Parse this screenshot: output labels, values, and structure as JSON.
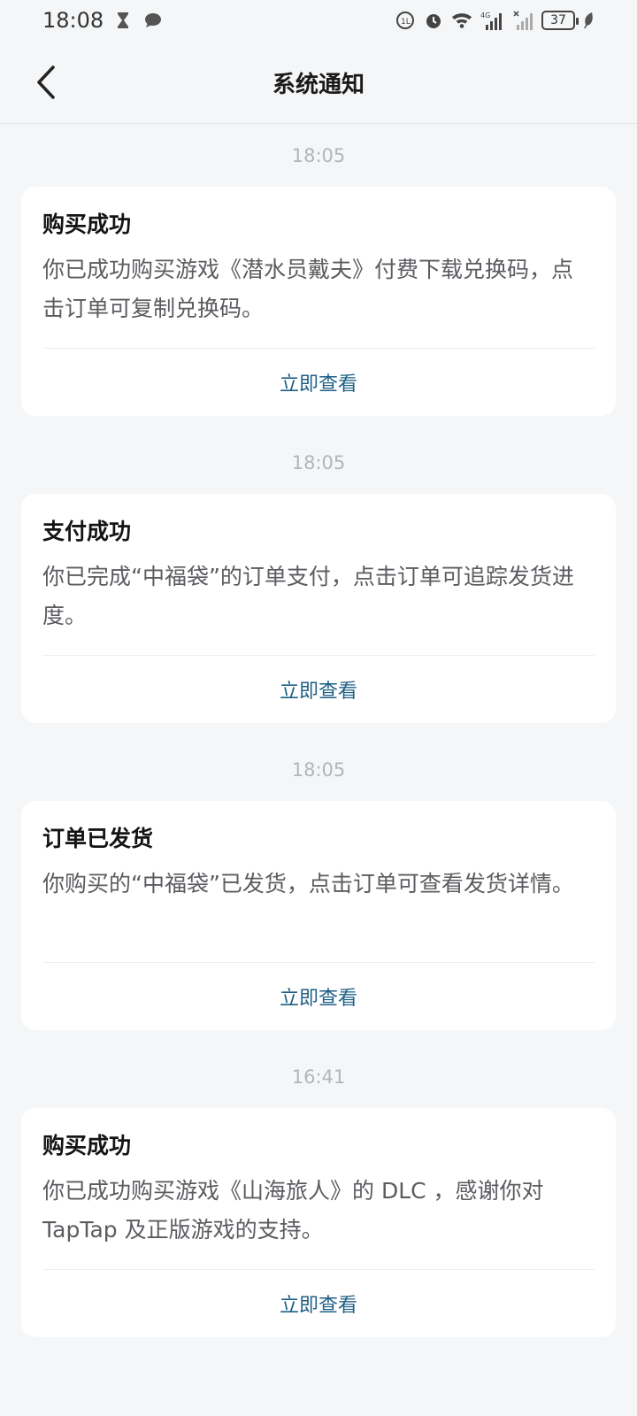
{
  "status_bar": {
    "time": "18:08",
    "battery": "37",
    "network": "4G",
    "icons": [
      "hourglass-icon",
      "chat-bubble-icon",
      "hd-icon",
      "alarm-icon",
      "wifi-icon",
      "signal-icon",
      "signal-off-icon",
      "battery-icon",
      "leaf-icon"
    ]
  },
  "nav": {
    "title": "系统通知",
    "back_icon": "chevron-left-icon"
  },
  "notifications": [
    {
      "time": "18:05",
      "title": "购买成功",
      "body": "你已成功购买游戏《潜水员戴夫》付费下载兑换码，点击订单可复制兑换码。",
      "action": "立即查看"
    },
    {
      "time": "18:05",
      "title": "支付成功",
      "body": "你已完成“中福袋”的订单支付，点击订单可追踪发货进度。",
      "action": "立即查看"
    },
    {
      "time": "18:05",
      "title": "订单已发货",
      "body": "你购买的“中福袋”已发货，点击订单可查看发货详情。",
      "action": "立即查看"
    },
    {
      "time": "16:41",
      "title": "购买成功",
      "body": "你已成功购买游戏《山海旅人》的 DLC ，感谢你对 TapTap 及正版游戏的支持。",
      "action": "立即查看"
    }
  ],
  "colors": {
    "background": "#f5f6f8",
    "card": "#ffffff",
    "action": "#1f5f86",
    "timestamp": "#b3b5ba"
  }
}
